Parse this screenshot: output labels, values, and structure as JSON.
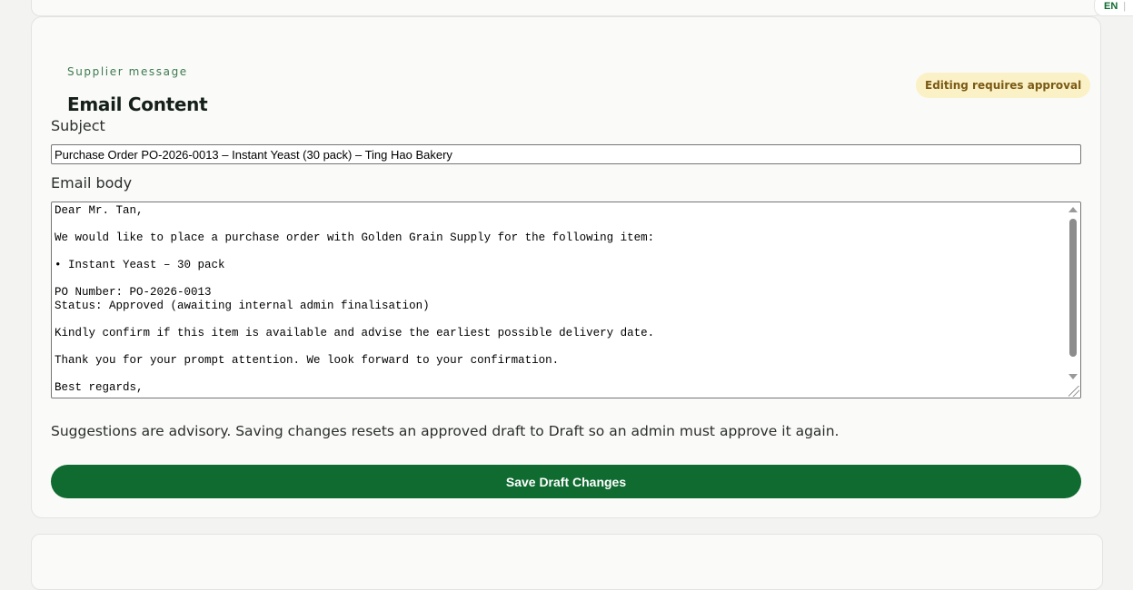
{
  "language": {
    "current": "EN",
    "separator": "|"
  },
  "section": {
    "eyebrow": "Supplier message",
    "title": "Email Content",
    "badge": "Editing requires approval"
  },
  "subject": {
    "label": "Subject",
    "value": "Purchase Order PO-2026-0013 – Instant Yeast (30 pack) – Ting Hao Bakery"
  },
  "body": {
    "label": "Email body",
    "value": "Dear Mr. Tan,\n\nWe would like to place a purchase order with Golden Grain Supply for the following item:\n\n• Instant Yeast – 30 pack\n\nPO Number: PO-2026-0013\nStatus: Approved (awaiting internal admin finalisation)\n\nKindly confirm if this item is available and advise the earliest possible delivery date.\n\nThank you for your prompt attention. We look forward to your confirmation.\n\nBest regards,"
  },
  "hint": "Suggestions are advisory. Saving changes resets an approved draft to Draft so an admin must approve it again.",
  "actions": {
    "save_label": "Save Draft Changes"
  },
  "colors": {
    "accent": "#0f6b30",
    "badge_bg": "#fbf1c6",
    "badge_text": "#7a5a14"
  }
}
